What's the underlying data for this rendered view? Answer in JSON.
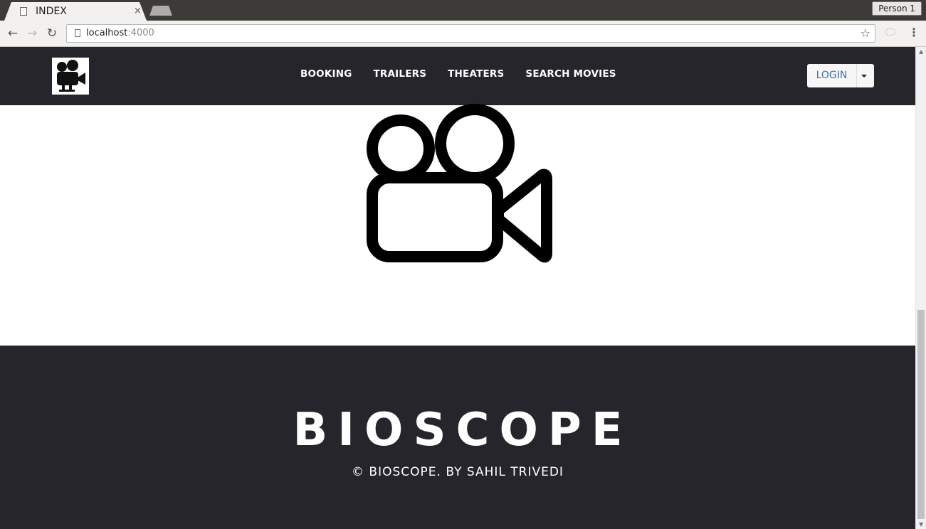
{
  "browser": {
    "tab_title": "INDEX",
    "tab_close": "×",
    "profile": "Person 1",
    "url_host": "localhost",
    "url_port": ":4000",
    "back": "←",
    "forward": "→",
    "reload": "↻",
    "star": "☆",
    "menu": "⋮"
  },
  "nav": {
    "links": [
      "BOOKING",
      "TRAILERS",
      "THEATERS",
      "SEARCH MOVIES"
    ],
    "login_label": "LOGIN"
  },
  "footer": {
    "title": "BIOSCOPE",
    "copyright": "© BIOSCOPE. BY SAHIL TRIVEDI"
  },
  "icons": {
    "logo": "movie-camera-icon",
    "hero": "movie-camera-outline-icon"
  }
}
